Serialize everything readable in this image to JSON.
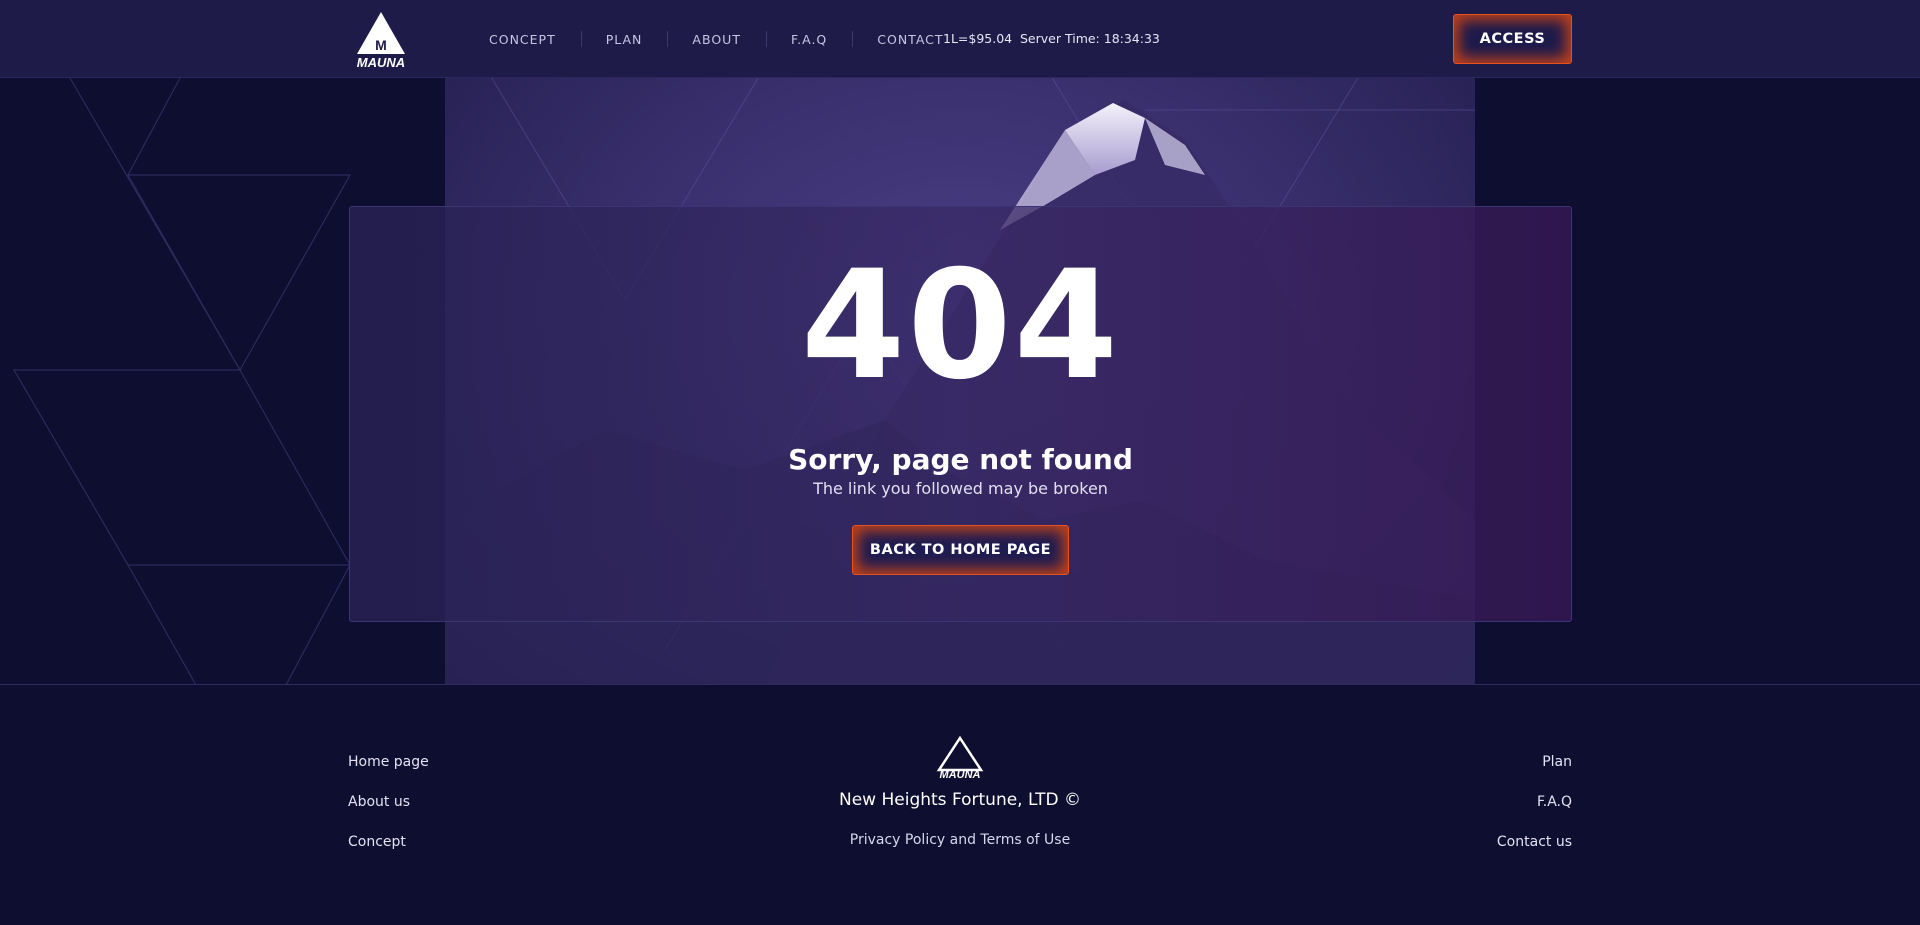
{
  "header": {
    "logo_text": "MAUNA",
    "logo_letter": "M",
    "nav": [
      "CONCEPT",
      "PLAN",
      "ABOUT",
      "F.A.Q",
      "CONTACT"
    ],
    "price": "1L=$95.04",
    "server_time": "Server Time: 18:34:33",
    "access_label": "ACCESS"
  },
  "error": {
    "code": "404",
    "title": "Sorry, page not found",
    "subtitle": "The link you followed may be broken",
    "button_label": "BACK TO HOME PAGE"
  },
  "footer": {
    "left_links": [
      "Home page",
      "About us",
      "Concept"
    ],
    "right_links": [
      "Plan",
      "F.A.Q",
      "Contact us"
    ],
    "company": "New Heights Fortune, LTD ©",
    "policy": "Privacy Policy and Terms of Use",
    "logo_text": "MAUNA"
  },
  "colors": {
    "background": "#0e0e30",
    "header": "#1e1b48",
    "accent": "#e2531f"
  },
  "icons": [
    "mauna-logo-icon",
    "mauna-footer-logo-icon"
  ]
}
